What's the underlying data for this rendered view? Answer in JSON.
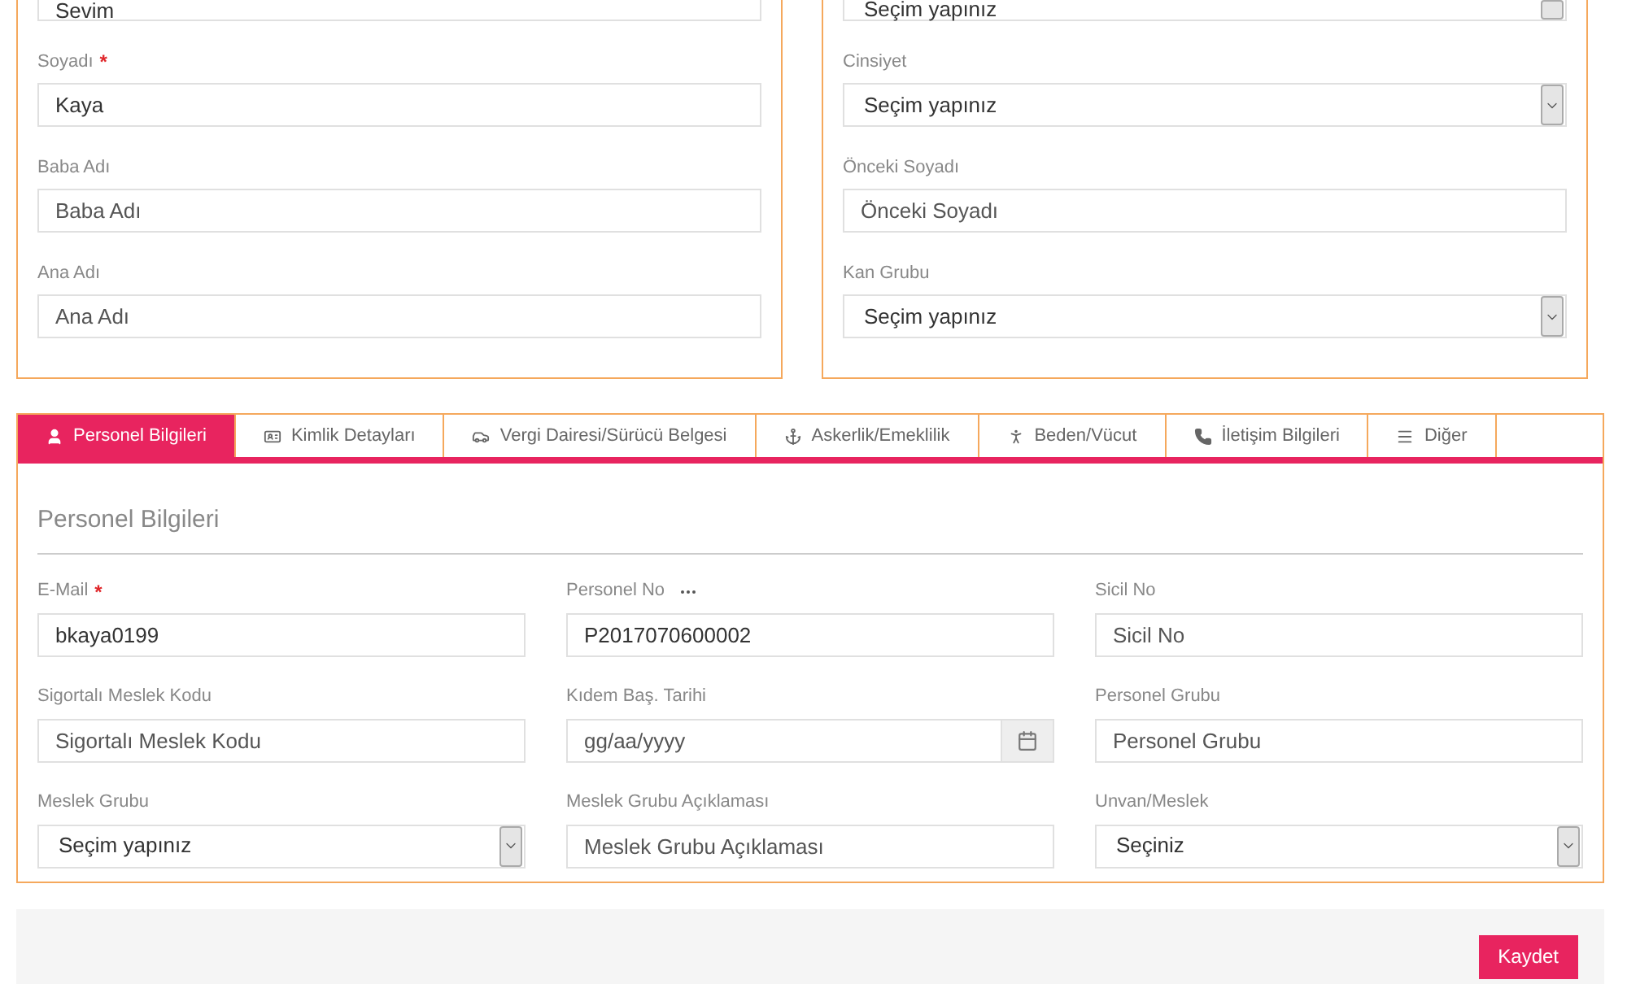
{
  "top_cards": [
    {
      "fields": [
        {
          "kind": "text",
          "value": "Sevim",
          "partial": true
        },
        {
          "kind": "text",
          "label": "Soyadı",
          "required_mark": "*",
          "value": "Kaya"
        },
        {
          "kind": "text",
          "label": "Baba Adı",
          "placeholder": "Baba Adı"
        },
        {
          "kind": "text",
          "label": "Ana Adı",
          "placeholder": "Ana Adı"
        }
      ]
    },
    {
      "fields": [
        {
          "kind": "select",
          "value": "Seçim yapınız",
          "partial": true
        },
        {
          "kind": "select",
          "label": "Cinsiyet",
          "value": "Seçim yapınız"
        },
        {
          "kind": "text",
          "label": "Önceki Soyadı",
          "placeholder": "Önceki Soyadı"
        },
        {
          "kind": "select",
          "label": "Kan Grubu",
          "value": "Seçim yapınız"
        }
      ]
    }
  ],
  "tabs": [
    {
      "label": "Personel Bilgileri",
      "selected": true
    },
    {
      "label": "Kimlik Detayları",
      "selected": false
    },
    {
      "label": "Vergi Dairesi/Sürücü Belgesi",
      "selected": false
    },
    {
      "label": "Askerlik/Emeklilik",
      "selected": false
    },
    {
      "label": "Beden/Vücut",
      "selected": false
    },
    {
      "label": "İletişim Bilgileri",
      "selected": false
    },
    {
      "label": "Diğer",
      "selected": false
    }
  ],
  "section_title": "Personel Bilgileri",
  "fields": [
    {
      "kind": "text",
      "label": "E-Mail",
      "required_mark": "*",
      "value": "bkaya0199"
    },
    {
      "kind": "text",
      "label": "Personel No",
      "more": true,
      "value": "P2017070600002"
    },
    {
      "kind": "text",
      "label": "Sicil No",
      "placeholder": "Sicil No"
    },
    {
      "kind": "text",
      "label": "Sigortalı Meslek Kodu",
      "placeholder": "Sigortalı Meslek Kodu"
    },
    {
      "kind": "date",
      "label": "Kıdem Baş. Tarihi",
      "placeholder": "gg/aa/yyyy"
    },
    {
      "kind": "text",
      "label": "Personel Grubu",
      "placeholder": "Personel Grubu"
    },
    {
      "kind": "select",
      "label": "Meslek Grubu",
      "value": "Seçim yapınız"
    },
    {
      "kind": "text",
      "label": "Meslek Grubu Açıklaması",
      "placeholder": "Meslek Grubu Açıklaması"
    },
    {
      "kind": "select",
      "label": "Unvan/Meslek",
      "value": "Seçiniz"
    }
  ],
  "save_button": "Kaydet"
}
